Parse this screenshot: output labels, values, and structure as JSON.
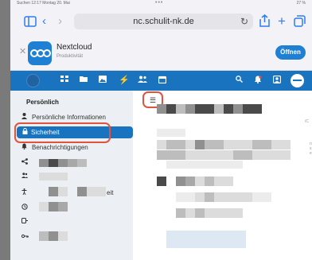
{
  "status_bar": {
    "left_text": "Suchen 12:17  Montag 20. Mai",
    "center_text": "•••",
    "right_text": "27 %"
  },
  "safari": {
    "url": "nc.schulit-nk.de",
    "icons": {
      "sidebar": "sidebar-icon",
      "back": "chevron-left-icon",
      "forward": "chevron-right-icon",
      "reload": "reload-icon",
      "share": "share-icon",
      "new_tab": "plus-icon",
      "tabs": "tabs-icon"
    }
  },
  "app_banner": {
    "name": "Nextcloud",
    "subtitle": "Produktivität",
    "open_label": "Öffnen"
  },
  "nc_header": {
    "icons": [
      "dashboard-icon",
      "files-icon",
      "photos-icon",
      "activity-icon",
      "contacts-icon",
      "calendar-icon",
      "search-icon",
      "notifications-icon",
      "contacts-menu-icon",
      "user-avatar"
    ]
  },
  "sidebar": {
    "title": "Persönlich",
    "items": [
      {
        "label": "Persönliche Informationen",
        "icon": "person-icon"
      },
      {
        "label": "Sicherheit",
        "icon": "lock-icon",
        "active": true
      },
      {
        "label": "Benachrichtigungen",
        "icon": "bell-icon"
      },
      {
        "label": "",
        "icon": "share-icon"
      },
      {
        "label": "",
        "icon": "groups-icon"
      },
      {
        "label": "eit",
        "icon": "accessibility-icon"
      },
      {
        "label": "",
        "icon": "clock-icon"
      },
      {
        "label": "",
        "icon": "flow-icon"
      },
      {
        "label": "",
        "icon": "key-icon"
      }
    ]
  },
  "content": {
    "menu_icon": "hamburger-icon",
    "fragments": [
      "/C",
      "n s",
      "ei"
    ]
  },
  "colors": {
    "nc_blue": "#1a73be",
    "highlight_red": "#e0543f",
    "safari_blue": "#2f7bf5"
  }
}
